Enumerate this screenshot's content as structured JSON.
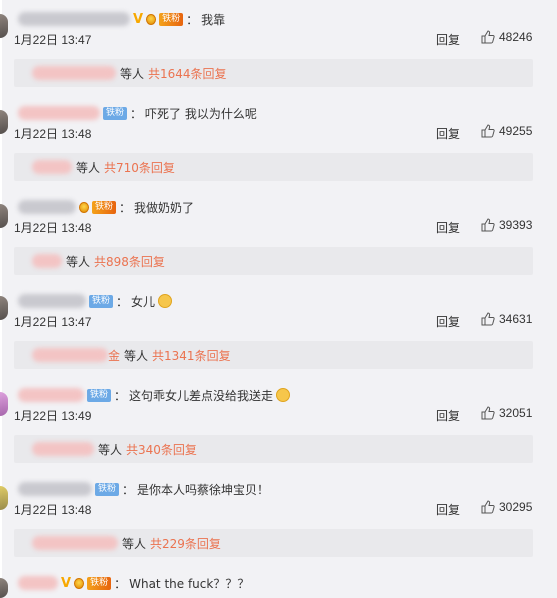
{
  "comments": [
    {
      "text": "我靠",
      "date": "1月22日 13:47",
      "reply": "回复",
      "likes": "48246",
      "sub": {
        "suffix": "等人",
        "count": "共1644条回复"
      },
      "badges": {
        "v": "V",
        "medal": true,
        "fan": "铁粉"
      }
    },
    {
      "text": "吓死了 我以为什么呢",
      "date": "1月22日 13:48",
      "reply": "回复",
      "likes": "49255",
      "sub": {
        "suffix": "等人",
        "count": "共710条回复"
      },
      "badges": {
        "fan": "铁粉"
      }
    },
    {
      "text": "我做奶奶了",
      "date": "1月22日 13:48",
      "reply": "回复",
      "likes": "39393",
      "sub": {
        "suffix": "等人",
        "count": "共898条回复"
      },
      "badges": {
        "medal": true,
        "fan": "铁粉"
      }
    },
    {
      "text": "女儿",
      "date": "1月22日 13:47",
      "reply": "回复",
      "likes": "34631",
      "sub": {
        "prefix": "金",
        "suffix": "等人",
        "count": "共1341条回复"
      },
      "badges": {
        "fan": "铁粉"
      },
      "emoji": true
    },
    {
      "text": "这句乖女儿差点没给我送走",
      "date": "1月22日 13:49",
      "reply": "回复",
      "likes": "32051",
      "sub": {
        "suffix": "等人",
        "count": "共340条回复"
      },
      "badges": {
        "fan": "铁粉"
      },
      "emoji": true
    },
    {
      "text": "是你本人吗蔡徐坤宝贝！",
      "date": "1月22日 13:48",
      "reply": "回复",
      "likes": "30295",
      "sub": {
        "suffix": "等人",
        "count": "共229条回复"
      },
      "badges": {
        "fan": "铁粉"
      }
    },
    {
      "text": "What the fuck？？？",
      "badges": {
        "v": "V",
        "medal": true,
        "fan": "铁粉"
      }
    }
  ],
  "colon": "：",
  "colors": {
    "accent_reply_count": "#eb7350",
    "fan_badge": "#6ca9e6",
    "fan_badge_gold": "#f4a21a",
    "vip": "#f7a800"
  }
}
